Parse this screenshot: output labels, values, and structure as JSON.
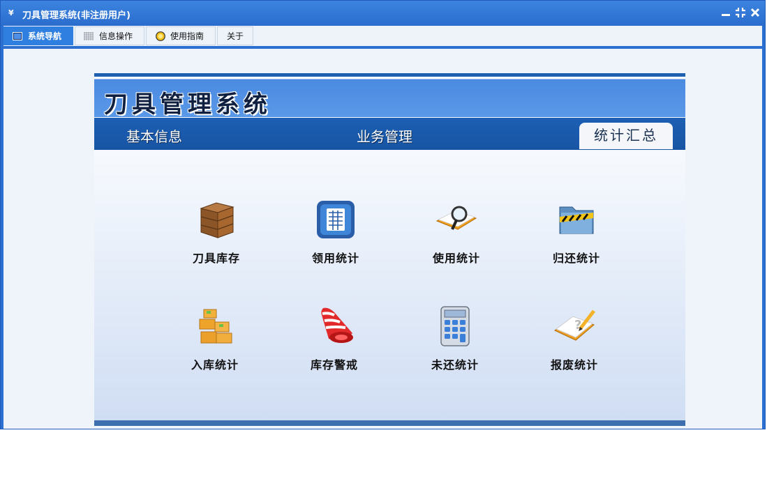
{
  "window": {
    "title": "刀具管理系统(非注册用户)"
  },
  "tabs": [
    {
      "label": "系统导航",
      "active": true
    },
    {
      "label": "信息操作",
      "active": false
    },
    {
      "label": "使用指南",
      "active": false
    },
    {
      "label": "关于",
      "active": false
    }
  ],
  "panel": {
    "system_title": "刀具管理系统",
    "nav": {
      "basic": "基本信息",
      "business": "业务管理",
      "statistics": "统计汇总"
    }
  },
  "tiles": [
    {
      "label": "刀具库存",
      "icon": "wooden-crate-icon"
    },
    {
      "label": "领用统计",
      "icon": "calculator-app-icon"
    },
    {
      "label": "使用统计",
      "icon": "book-magnifier-icon"
    },
    {
      "label": "归还统计",
      "icon": "folder-hazard-icon"
    },
    {
      "label": "入库统计",
      "icon": "stacked-boxes-icon"
    },
    {
      "label": "库存警戒",
      "icon": "alarm-bell-icon"
    },
    {
      "label": "未还统计",
      "icon": "calculator-icon"
    },
    {
      "label": "报废统计",
      "icon": "notebook-pencil-icon"
    }
  ],
  "colors": {
    "accent": "#2b6fd0",
    "nav_bar": "#1c5fb3",
    "banner": "#4a8ae0"
  }
}
